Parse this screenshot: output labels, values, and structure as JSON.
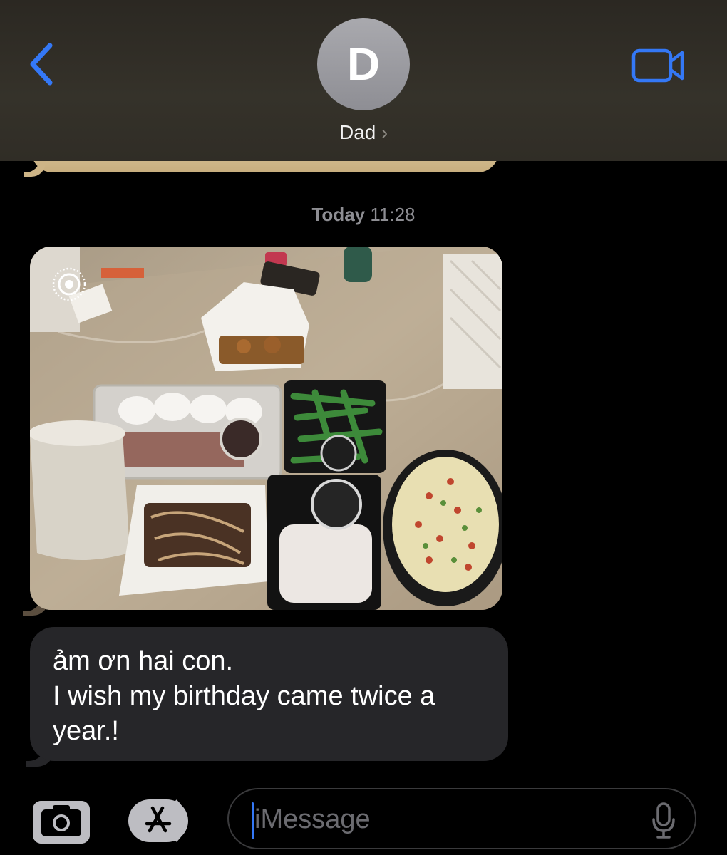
{
  "header": {
    "avatar_initial": "D",
    "contact_name": "Dad",
    "contact_chevron": "›",
    "back_icon": "chevron-left-icon",
    "video_icon": "video-camera-icon"
  },
  "timestamp": {
    "day": "Today",
    "time": "11:28"
  },
  "messages": [
    {
      "type": "photo",
      "description_icon": "live-photo-icon"
    },
    {
      "type": "text",
      "lines": [
        "ảm ơn hai con.",
        "I wish my birthday came twice a",
        "year.!"
      ]
    }
  ],
  "composer": {
    "placeholder": "iMessage",
    "camera_icon": "camera-icon",
    "apps_icon": "app-store-icon",
    "mic_icon": "microphone-icon"
  },
  "colors": {
    "accent": "#3478f6",
    "incoming_bubble": "#262629",
    "header_bg": "#302d26",
    "avatar_bg": "#9c9ca1"
  }
}
